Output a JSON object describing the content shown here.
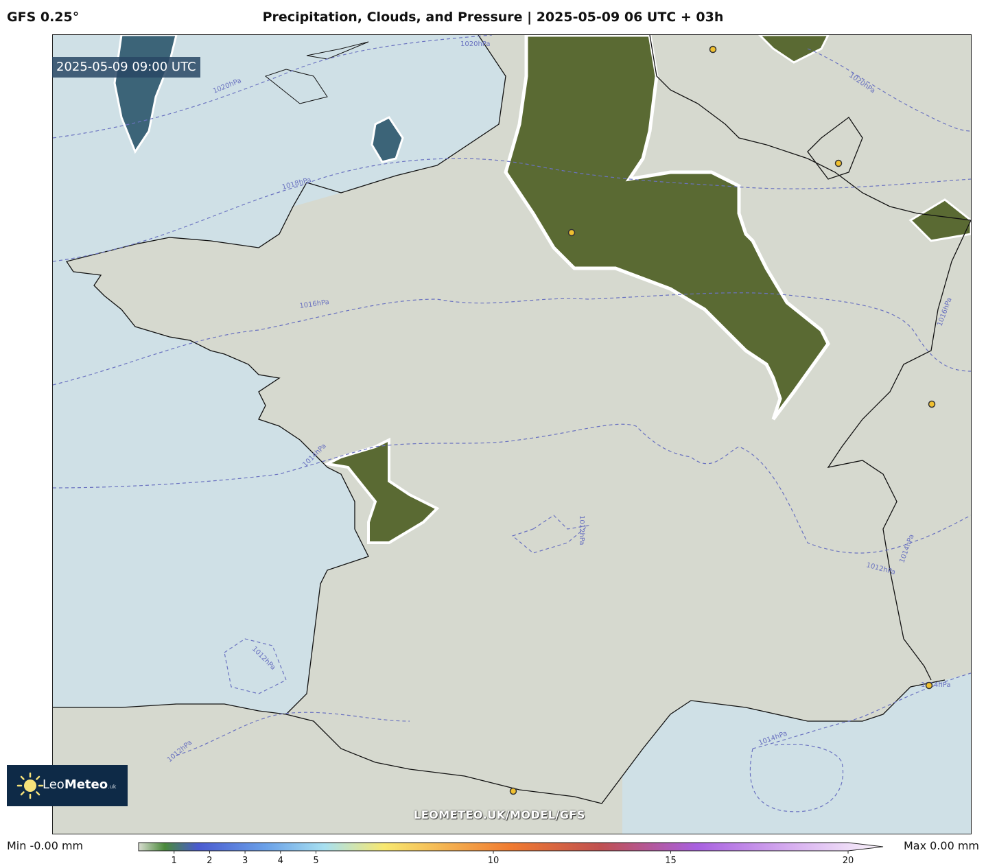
{
  "header": {
    "model": "GFS 0.25°",
    "title": "Precipitation, Clouds, and Pressure | 2025-05-09 06 UTC + 03h"
  },
  "map": {
    "valid_time": "2025-05-09 09:00 UTC",
    "watermark": "LEOMETEO.UK/MODEL/GFS",
    "isobar_labels": [
      "1020hPa",
      "1020hPa",
      "1020hPa",
      "1018hPa",
      "1016hPa",
      "1016hPa",
      "1014hPa",
      "1014hPa",
      "1014hPa",
      "1014hPa",
      "1012hPa",
      "1012hPa",
      "1012hPa",
      "1012hPa"
    ],
    "colors": {
      "sea": "#cfe0e6",
      "land": "#d6d9cf",
      "cloud_free_land": "#5d6a35",
      "isobar": "#6a72c0"
    }
  },
  "logo": {
    "brand_light": "Leo",
    "brand_bold": "Meteo",
    "suffix": ".uk"
  },
  "colorbar": {
    "min_label": "Min -0.00 mm",
    "max_label": "Max 0.00 mm",
    "ticks": [
      "1",
      "2",
      "3",
      "4",
      "5",
      "10",
      "15",
      "20"
    ],
    "tick_values": [
      1,
      2,
      3,
      4,
      5,
      10,
      15,
      20
    ],
    "range": [
      0,
      20
    ]
  }
}
